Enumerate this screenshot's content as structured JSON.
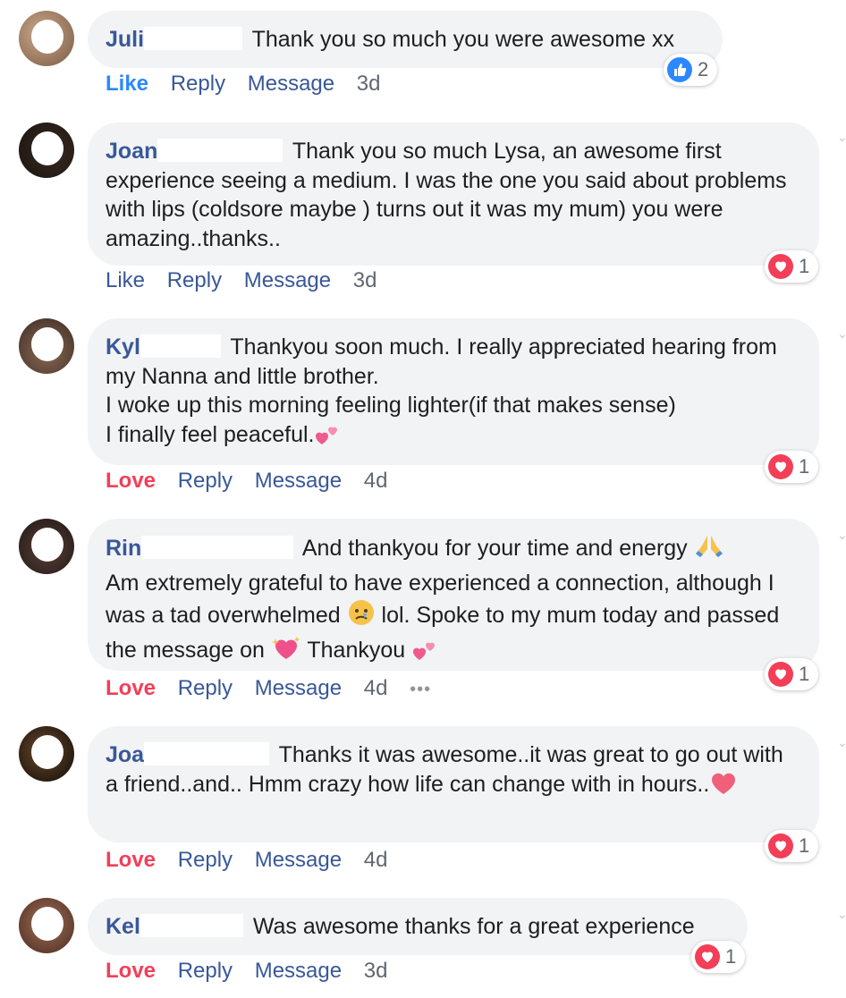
{
  "actions": {
    "like": "Like",
    "love": "Love",
    "reply": "Reply",
    "message": "Message",
    "more": "•••"
  },
  "comments": [
    {
      "author": "Juli",
      "text": "Thank you so much you were awesome xx",
      "action_state": "Like",
      "time": "3d",
      "reaction_type": "like",
      "reaction_count": "2"
    },
    {
      "author": "Joan",
      "text": "Thank you so much Lysa, an awesome first experience seeing a medium. I was the one you said about problems with lips (coldsore maybe ) turns out it was my mum) you were amazing..thanks..",
      "action_state": "Like",
      "time": "3d",
      "reaction_type": "love",
      "reaction_count": "1"
    },
    {
      "author": "Kyl",
      "text_lines": [
        "Thankyou soon much. I really appreciated hearing from my Nanna and little brother.",
        "I woke up this morning feeling lighter(if that makes sense)",
        "I finally feel peaceful."
      ],
      "action_state": "Love",
      "time": "4d",
      "reaction_type": "love",
      "reaction_count": "1"
    },
    {
      "author": "Rin",
      "text_part1": "And thankyou for your time and energy",
      "text_part2": "Am extremely grateful to have experienced a connection, although I was a tad overwhelmed",
      "text_part3": "lol. Spoke to my mum today and passed the message on",
      "text_part4": "Thankyou",
      "action_state": "Love",
      "time": "4d",
      "reaction_type": "love",
      "reaction_count": "1"
    },
    {
      "author": "Joa",
      "text": "Thanks it was awesome..it was great to go out with a friend..and.. Hmm crazy how life can change with in hours..",
      "action_state": "Love",
      "time": "4d",
      "reaction_type": "love",
      "reaction_count": "1"
    },
    {
      "author": "Kel",
      "text": "Was awesome thanks for a great experience",
      "action_state": "Love",
      "time": "3d",
      "reaction_type": "love",
      "reaction_count": "1"
    }
  ],
  "icons": {
    "like": "thumbs-up-icon",
    "love": "heart-icon",
    "pray": "folded-hands-icon",
    "sad": "sad-tear-face-icon",
    "sparkle_heart": "sparkling-heart-icon",
    "two_hearts": "two-hearts-icon"
  },
  "colors": {
    "author": "#385898",
    "love": "#f33e58",
    "like": "#2d88ff",
    "bubble": "#f2f3f5",
    "time": "#606770"
  }
}
